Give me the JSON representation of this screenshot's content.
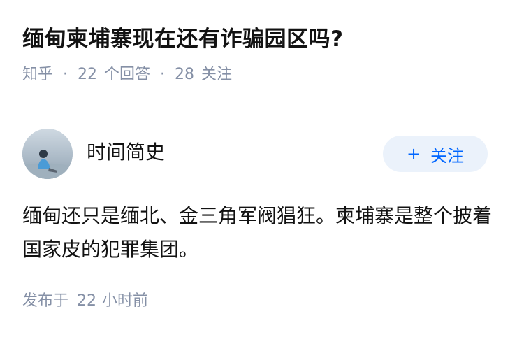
{
  "question": {
    "title": "缅甸柬埔寨现在还有诈骗园区吗?",
    "source": "知乎",
    "separator": "·",
    "answer_count": "22",
    "answer_label": "个回答",
    "follower_count": "28",
    "follower_label": "关注"
  },
  "answer": {
    "author_name": "时间简史",
    "avatar_icon": "avatar-person-icon",
    "follow_button": {
      "plus": "+",
      "label": "关注"
    },
    "content": "缅甸还只是缅北、金三角军阀猖狂。柬埔寨是整个披着国家皮的犯罪集团。",
    "footer": {
      "prefix": "发布于",
      "number": "22",
      "unit": "小时前"
    }
  },
  "colors": {
    "title": "#121212",
    "meta": "#8590a6",
    "accent": "#0066ff",
    "follow_bg": "#ebf2fb",
    "divider": "#ebebeb"
  }
}
